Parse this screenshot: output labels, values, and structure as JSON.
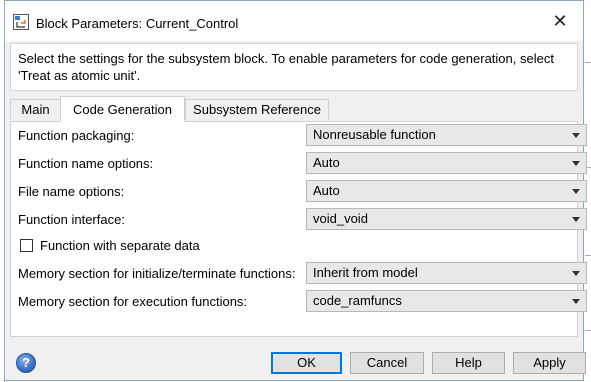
{
  "window": {
    "title": "Block Parameters: Current_Control",
    "close_glyph": "✕"
  },
  "description": "Select the settings for the subsystem block. To enable parameters for code generation, select 'Treat as atomic unit'.",
  "tabs": [
    {
      "label": "Main",
      "active": false
    },
    {
      "label": "Code Generation",
      "active": true
    },
    {
      "label": "Subsystem Reference",
      "active": false
    }
  ],
  "fields": {
    "function_packaging": {
      "label": "Function packaging:",
      "value": "Nonreusable function"
    },
    "function_name_options": {
      "label": "Function name options:",
      "value": "Auto"
    },
    "file_name_options": {
      "label": "File name options:",
      "value": "Auto"
    },
    "function_interface": {
      "label": "Function interface:",
      "value": "void_void"
    },
    "separate_data": {
      "label": "Function with separate data",
      "checked": false
    },
    "memory_init_term": {
      "label": "Memory section for initialize/terminate functions:",
      "value": "Inherit from model"
    },
    "memory_exec": {
      "label": "Memory section for execution functions:",
      "value": "code_ramfuncs"
    }
  },
  "buttons": {
    "help_glyph": "?",
    "ok": "OK",
    "cancel": "Cancel",
    "help": "Help",
    "apply": "Apply"
  },
  "colors": {
    "accent": "#0078d7",
    "dialog_bg": "#f0f0f0",
    "select_bg": "#e8e8e8"
  },
  "icons": {
    "title": "simulink-block-icon",
    "close": "close-icon",
    "help": "help-icon"
  }
}
